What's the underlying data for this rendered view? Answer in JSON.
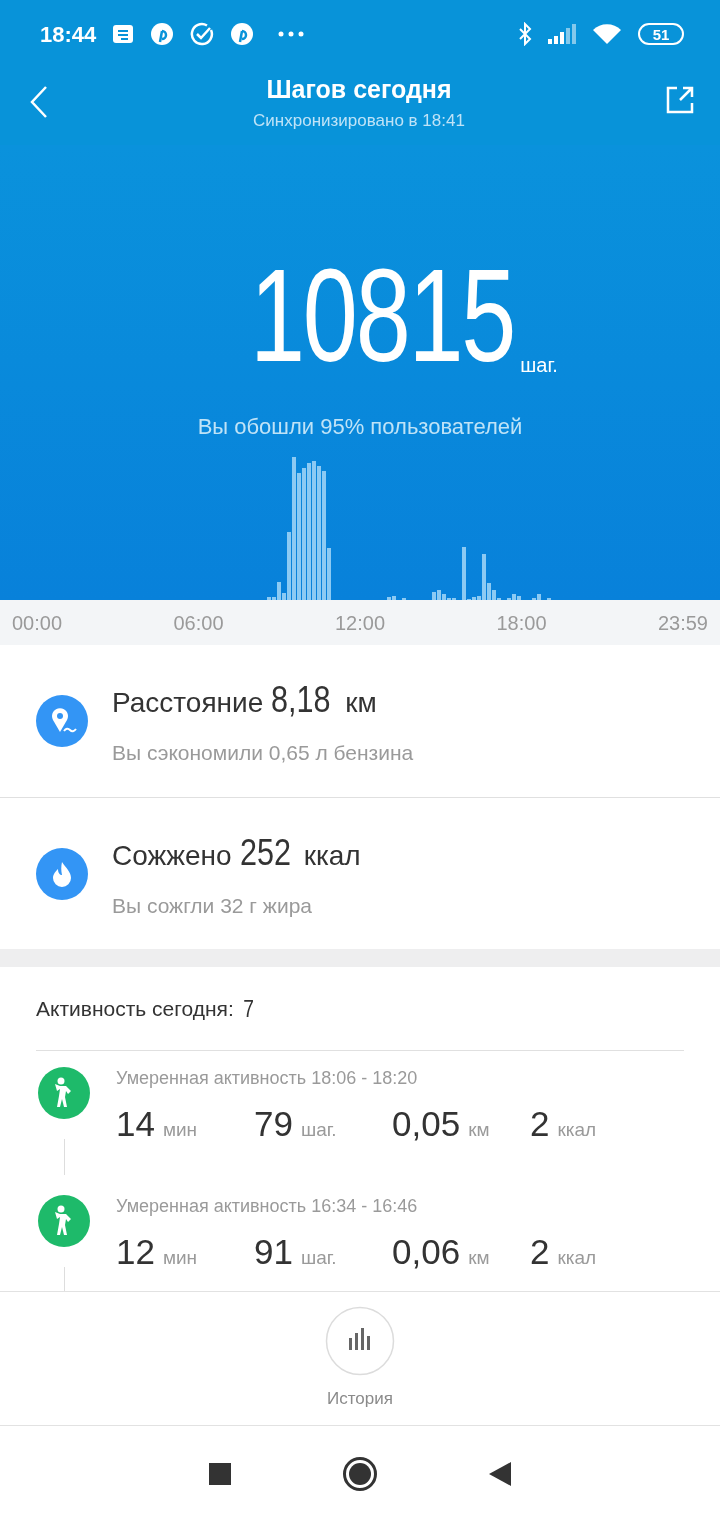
{
  "status_bar": {
    "time": "18:44",
    "battery": "51"
  },
  "header": {
    "title": "Шагов сегодня",
    "subtitle": "Синхронизировано в 18:41"
  },
  "hero": {
    "steps": "10815",
    "unit": "шаг.",
    "caption": "Вы обошли 95% пользователей"
  },
  "timeline": {
    "labels": [
      "00:00",
      "06:00",
      "12:00",
      "18:00",
      "23:59"
    ]
  },
  "summary": [
    {
      "kind": "distance",
      "label": "Расстояние",
      "value": "8,18",
      "unit": "км",
      "note": "Вы сэкономили 0,65 л бензина"
    },
    {
      "kind": "calories",
      "label": "Сожжено",
      "value": "252",
      "unit": "ккал",
      "note": "Вы сожгли 32 г жира"
    }
  ],
  "activity": {
    "title": "Активность сегодня:",
    "count": "7",
    "items": [
      {
        "title": "Умеренная активность 18:06 - 18:20",
        "stats": [
          {
            "value": "14",
            "unit": "мин"
          },
          {
            "value": "79",
            "unit": "шаг."
          },
          {
            "value": "0,05",
            "unit": "км"
          },
          {
            "value": "2",
            "unit": "ккал"
          }
        ]
      },
      {
        "title": "Умеренная активность 16:34 - 16:46",
        "stats": [
          {
            "value": "12",
            "unit": "мин"
          },
          {
            "value": "91",
            "unit": "шаг."
          },
          {
            "value": "0,06",
            "unit": "км"
          },
          {
            "value": "2",
            "unit": "ккал"
          }
        ]
      }
    ]
  },
  "history_button": {
    "label": "История"
  }
}
